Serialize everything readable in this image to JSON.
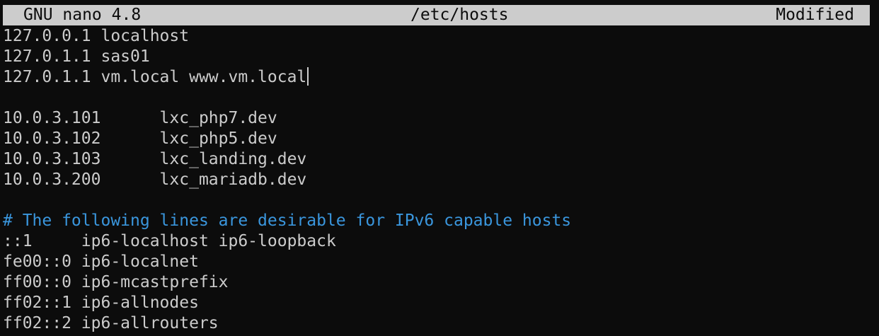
{
  "titlebar": {
    "app_version": "GNU nano 4.8",
    "file_name": "/etc/hosts",
    "status": "Modified"
  },
  "colors": {
    "background": "#0c0c0c",
    "text": "#cccccc",
    "comment": "#3a96dd",
    "titlebar_bg": "#cccccc",
    "titlebar_text": "#0c0c0c"
  },
  "editor": {
    "lines": [
      "127.0.0.1 localhost",
      "127.0.1.1 sas01",
      "127.0.1.1 vm.local www.vm.local",
      "",
      "10.0.3.101      lxc_php7.dev",
      "10.0.3.102      lxc_php5.dev",
      "10.0.3.103      lxc_landing.dev",
      "10.0.3.200      lxc_mariadb.dev",
      "",
      "# The following lines are desirable for IPv6 capable hosts",
      "::1     ip6-localhost ip6-loopback",
      "fe00::0 ip6-localnet",
      "ff00::0 ip6-mcastprefix",
      "ff02::1 ip6-allnodes",
      "ff02::2 ip6-allrouters"
    ]
  }
}
